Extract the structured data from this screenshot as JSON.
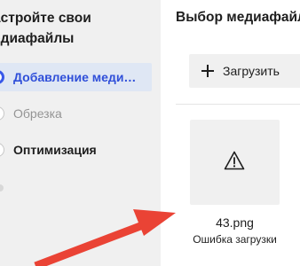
{
  "sidebar": {
    "title_line1": "астройте свои",
    "title_line2": "едиафайлы",
    "steps": [
      {
        "label": "Добавление меди…",
        "state": "active"
      },
      {
        "label": "Обрезка",
        "state": "pending"
      },
      {
        "label": "Оптимизация",
        "state": "pending"
      }
    ]
  },
  "panel": {
    "title": "Выбор медиафайл",
    "upload_label": "Загрузить",
    "media": [
      {
        "file_name": "43.png",
        "status": "Ошибка загрузки",
        "icon": "warning-icon"
      }
    ]
  },
  "colors": {
    "accent": "#3858e9",
    "active_bg": "#dfe7f4",
    "sidebar_bg": "#f0f0f0",
    "annotation_arrow": "#ea4335"
  }
}
